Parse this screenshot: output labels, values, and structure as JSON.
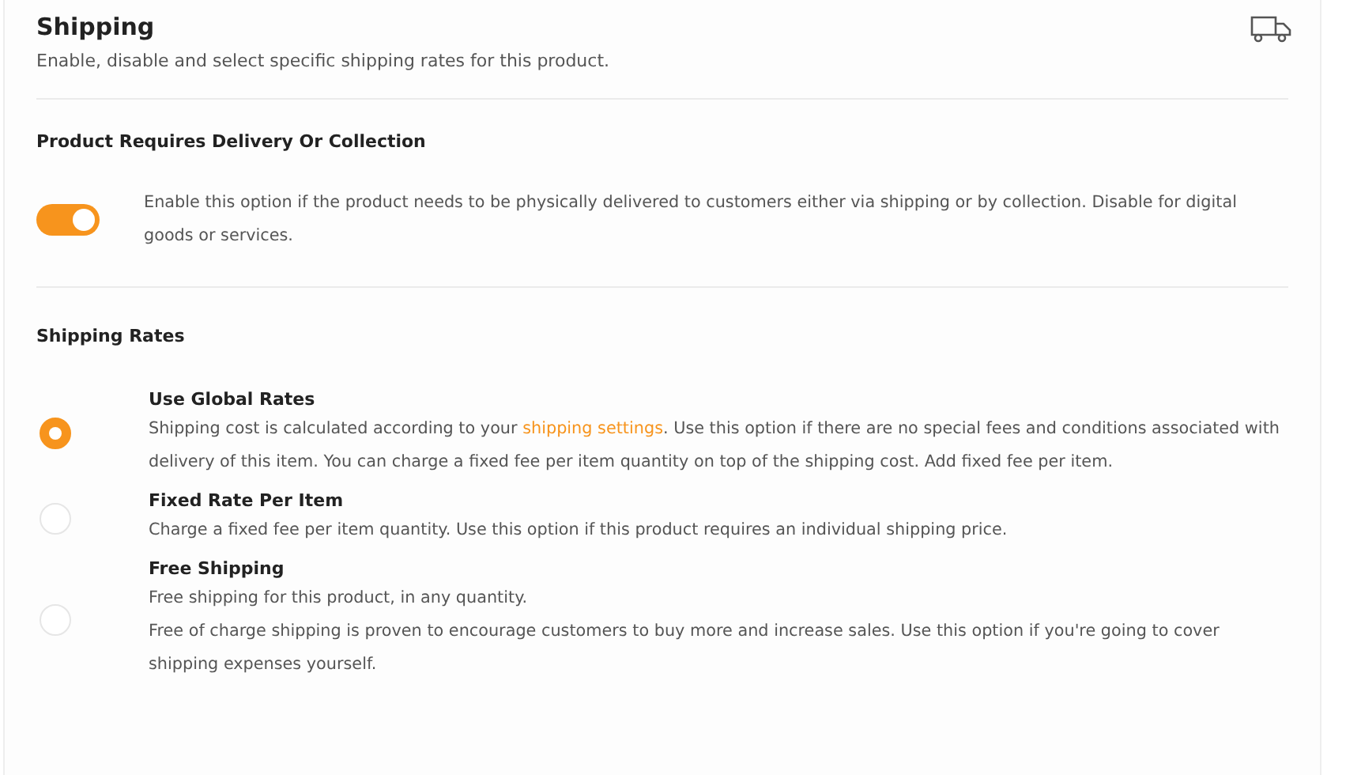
{
  "header": {
    "title": "Shipping",
    "subtitle": "Enable, disable and select specific shipping rates for this product."
  },
  "delivery": {
    "heading": "Product Requires Delivery Or Collection",
    "on": true,
    "description": "Enable this option if the product needs to be physically delivered to customers either via shipping or by collection. Disable for digital goods or services."
  },
  "rates": {
    "heading": "Shipping Rates",
    "options": [
      {
        "title": "Use Global Rates",
        "selected": true,
        "paragraphs": [
          {
            "before": "Shipping cost is calculated according to your ",
            "link": "shipping settings",
            "after": ". Use this option if there are no special fees and conditions associated with delivery of this item. You can charge a fixed fee per item quantity on top of the shipping cost. Add fixed fee per item."
          }
        ]
      },
      {
        "title": "Fixed Rate Per Item",
        "selected": false,
        "paragraphs": [
          {
            "before": "Charge a fixed fee per item quantity. Use this option if this product requires an individual shipping price."
          }
        ]
      },
      {
        "title": "Free Shipping",
        "selected": false,
        "paragraphs": [
          {
            "before": "Free shipping for this product, in any quantity."
          },
          {
            "before": "Free of charge shipping is proven to encourage customers to buy more and increase sales. Use this option if you're going to cover shipping expenses yourself."
          }
        ]
      }
    ]
  }
}
